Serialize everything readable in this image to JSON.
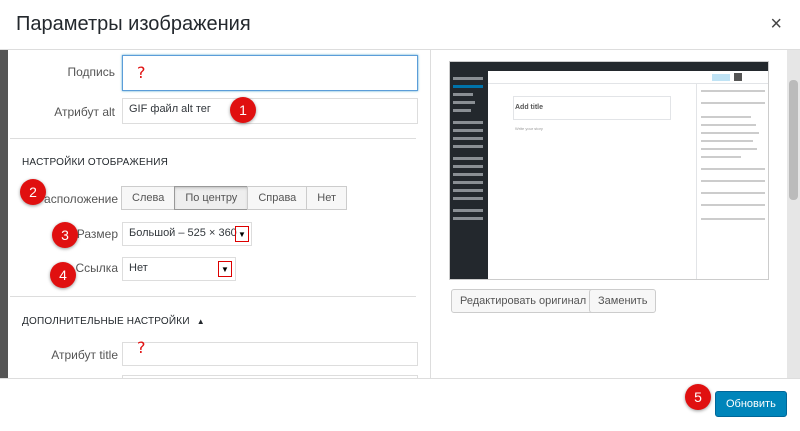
{
  "dialog": {
    "title": "Параметры изображения",
    "close_icon": "×"
  },
  "fields": {
    "caption_label": "Подпись",
    "caption_value": "",
    "alt_label": "Атрибут alt",
    "alt_value": "GIF файл alt тег"
  },
  "display_settings": {
    "title": "Настройки отображения",
    "align_label": "Расположение",
    "align_options": [
      "Слева",
      "По центру",
      "Справа",
      "Нет"
    ],
    "align_selected": "По центру",
    "size_label": "Размер",
    "size_value": "Большой – 525 × 360",
    "link_label": "Ссылка",
    "link_value": "Нет",
    "dropdown_arrow": "▼"
  },
  "advanced": {
    "title": "Дополнительные настройки",
    "toggle_icon": "▲",
    "title_attr_label": "Атрибут title",
    "title_attr_value": ""
  },
  "annotations": {
    "badges": [
      "1",
      "2",
      "3",
      "4",
      "5"
    ],
    "question_mark": "?"
  },
  "image_actions": {
    "edit_original": "Редактировать оригинал",
    "replace": "Заменить"
  },
  "footer": {
    "update_button": "Обновить"
  },
  "preview": {
    "title_placeholder": "Add title",
    "body_placeholder": "Write your story"
  },
  "colors": {
    "accent": "#0085ba",
    "badge": "#e01010"
  }
}
